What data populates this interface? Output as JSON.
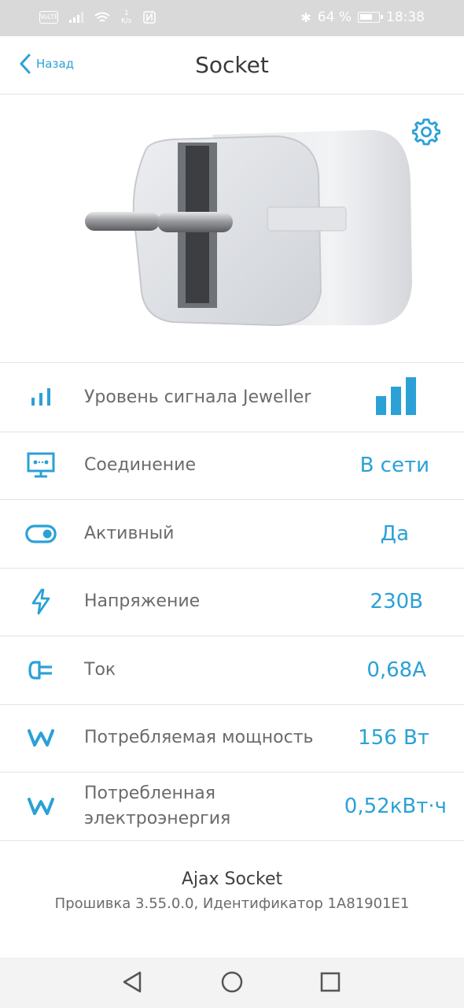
{
  "status_bar": {
    "carrier_icon_label": "VoLTE",
    "speed_top": "1",
    "speed_unit": "K/s",
    "battery_percent": "64 %",
    "time": "18:38"
  },
  "header": {
    "back_label": "Назад",
    "title": "Socket"
  },
  "rows": [
    {
      "icon": "signal-bars-icon",
      "label": "Уровень сигнала Jeweller",
      "value": "",
      "signal_level": 3,
      "signal_max": 3
    },
    {
      "icon": "connection-monitor-icon",
      "label": "Соединение",
      "value": "В сети"
    },
    {
      "icon": "toggle-icon",
      "label": "Активный",
      "value": "Да"
    },
    {
      "icon": "lightning-icon",
      "label": "Напряжение",
      "value": "230В"
    },
    {
      "icon": "plug-current-icon",
      "label": "Ток",
      "value": "0,68А"
    },
    {
      "icon": "w-power-icon",
      "label": "Потребляемая мощность",
      "value": "156 Вт"
    },
    {
      "icon": "w-energy-icon",
      "label": "Потребленная электроэнергия",
      "value": "0,52кВт·ч"
    }
  ],
  "footer": {
    "device_name": "Ajax Socket",
    "firmware_line": "Прошивка 3.55.0.0, Идентификатор 1A81901E1"
  },
  "colors": {
    "accent": "#2ba1d6",
    "divider": "#e3e3e3",
    "status_bar_bg": "#d9d9d9"
  }
}
